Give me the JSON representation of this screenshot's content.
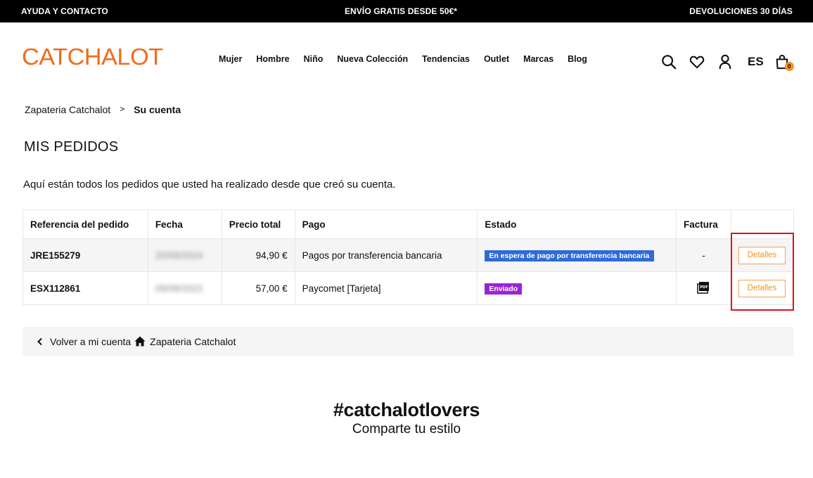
{
  "topbar": {
    "left": "AYUDA Y CONTACTO",
    "center": "ENVÍO GRATIS DESDE 50€*",
    "right": "DEVOLUCIONES 30 DÍAS"
  },
  "header": {
    "logo": "CATCHALOT",
    "nav": [
      "Mujer",
      "Hombre",
      "Niño",
      "Nueva Colección",
      "Tendencias",
      "Outlet",
      "Marcas",
      "Blog"
    ],
    "icons": [
      "search-icon",
      "heart-icon",
      "user-icon",
      "cart-icon"
    ],
    "language": "ES",
    "cart_count": "0"
  },
  "breadcrumb": {
    "home": "Zapateria Catchalot",
    "separator": ">",
    "current": "Su cuenta"
  },
  "page": {
    "title": "MIS PEDIDOS",
    "intro": "Aquí están todos los pedidos que usted ha realizado desde que creó su cuenta."
  },
  "orders_table": {
    "headers": [
      "Referencia del pedido",
      "Fecha",
      "Precio total",
      "Pago",
      "Estado",
      "Factura",
      ""
    ],
    "rows": [
      {
        "reference": "JRE155279",
        "date": "20/09/2024",
        "total": "94,90 €",
        "payment": "Pagos por transferencia bancaria",
        "status": "En espera de pago por transferencia bancaria",
        "status_color": "#2e6bd6",
        "invoice": "-",
        "action": "Detalles"
      },
      {
        "reference": "ESX112861",
        "date": "09/08/2022",
        "total": "57,00 €",
        "payment": "Paycomet [Tarjeta]",
        "status": "Enviado",
        "status_color": "#9b23d6",
        "invoice": "pdf-icon",
        "action": "Detalles"
      }
    ]
  },
  "footer_links": {
    "back": "Volver a mi cuenta",
    "home": "Zapateria Catchalot"
  },
  "promo": {
    "hashtag": "#catchalotlovers",
    "subtitle": "Comparte tu estilo"
  },
  "colors": {
    "brand": "#f26b1d",
    "accent": "#f7941d",
    "highlight": "#e0101a"
  }
}
